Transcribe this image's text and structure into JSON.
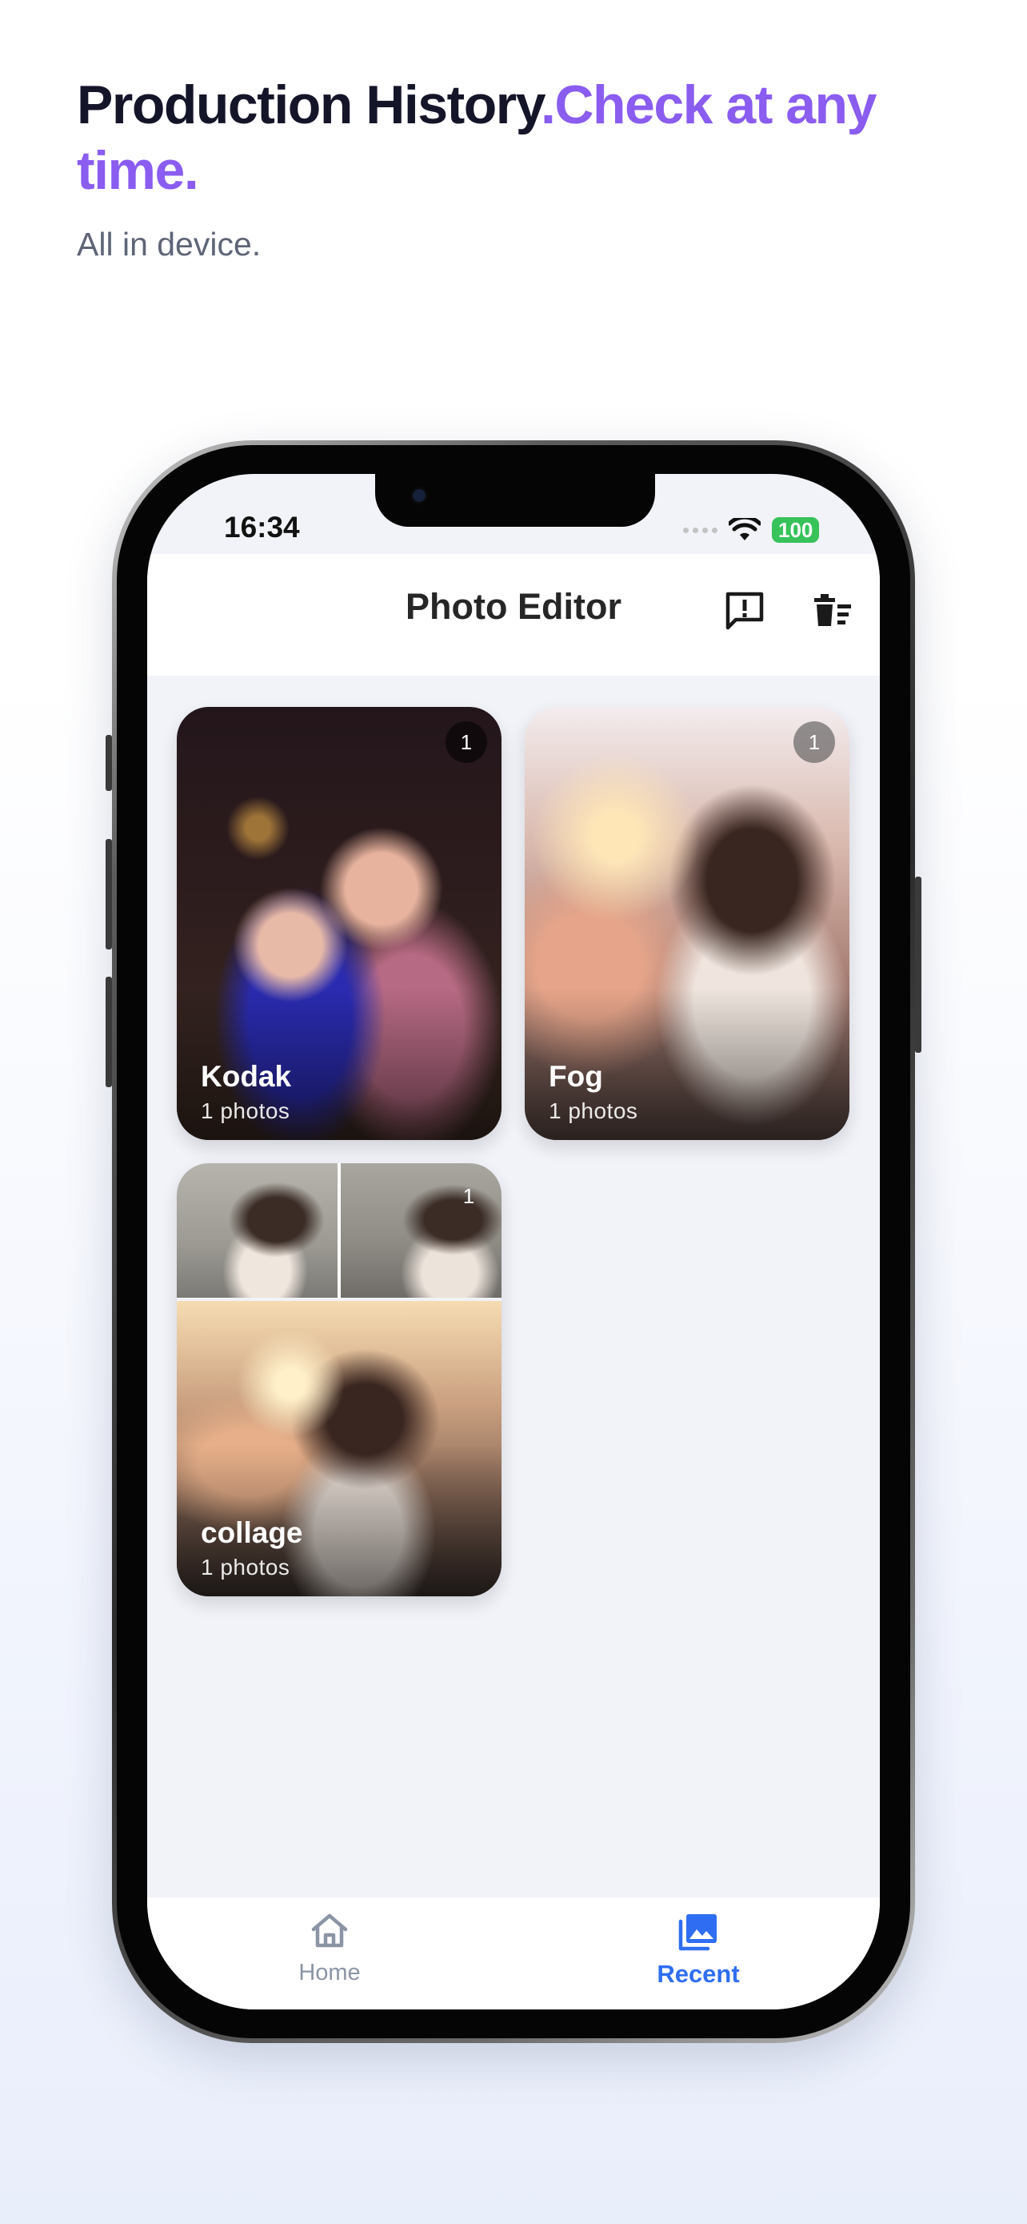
{
  "hero": {
    "title_main": "Production History",
    "title_accent": ".Check at any time.",
    "subtitle": "All in device."
  },
  "status_bar": {
    "time": "16:34",
    "battery": "100"
  },
  "app": {
    "title": "Photo Editor",
    "icons": {
      "feedback": "feedback-icon",
      "trash": "delete-all-icon"
    }
  },
  "albums": [
    {
      "title": "Kodak",
      "count": "1 photos",
      "badge": "1"
    },
    {
      "title": "Fog",
      "count": "1 photos",
      "badge": "1"
    },
    {
      "title": "collage",
      "count": "1 photos",
      "badge": "1"
    }
  ],
  "tabs": {
    "home": "Home",
    "recent": "Recent",
    "active": "recent"
  },
  "colors": {
    "accent_purple": "#8a5cf0",
    "tab_active": "#2f6ef2",
    "tab_inactive": "#8b95a5",
    "battery": "#37c25a"
  }
}
